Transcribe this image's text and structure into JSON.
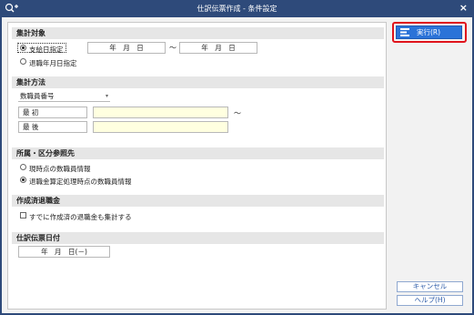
{
  "window": {
    "title": "仕訳伝票作成 - 条件設定",
    "close_glyph": "×"
  },
  "sections": {
    "target": {
      "heading": "集計対象",
      "option1": "支給日指定",
      "option2": "退職年月日指定",
      "date_from": "年　月　日",
      "tilde": "〜",
      "date_to": "年　月　日"
    },
    "method": {
      "heading": "集計方法",
      "select_value": "数職員番号",
      "first_label": "最 初",
      "last_label": "最 後",
      "first_value": "",
      "last_value": "",
      "tilde": "〜"
    },
    "affiliation": {
      "heading": "所属・区分参照先",
      "option1": "現時点の数職員情報",
      "option2": "退職金算定処理時点の数職員情報"
    },
    "created": {
      "heading": "作成済退職金",
      "checkbox_label": "すでに作成済の退職金も集計する"
    },
    "journal_date": {
      "heading": "仕訳伝票日付",
      "value": "年　月　日(－)"
    }
  },
  "buttons": {
    "execute": "実行(R)",
    "cancel": "キャンセル",
    "help": "ヘルプ(H)"
  },
  "colors": {
    "titlebar": "#2e4a7a",
    "accent_blue": "#2b73d8",
    "highlight_red": "#e0141c",
    "input_yellow": "#ffffe0"
  }
}
